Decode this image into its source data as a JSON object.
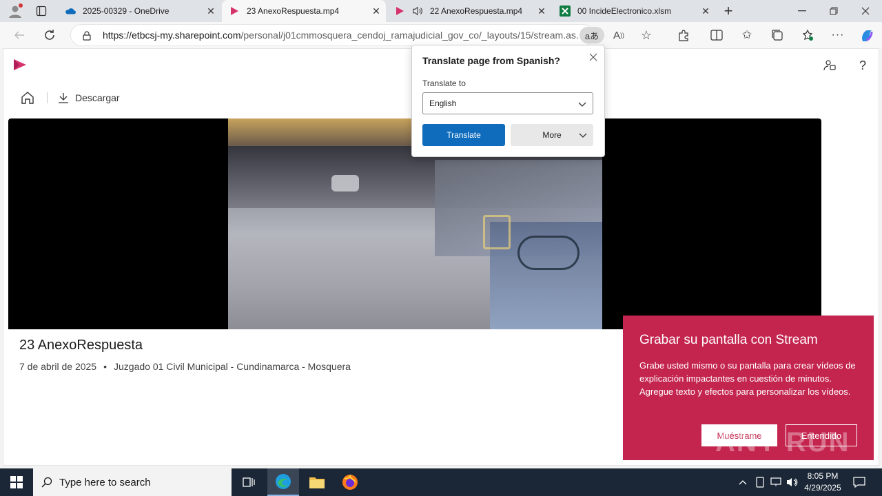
{
  "tabs": [
    {
      "label": "2025-00329 - OneDrive"
    },
    {
      "label": "23 AnexoRespuesta.mp4"
    },
    {
      "label": "22 AnexoRespuesta.mp4"
    },
    {
      "label": "00 IncideElectronico.xlsm"
    }
  ],
  "address": {
    "url_host": "https://etbcsj-my.sharepoint.com",
    "url_path": "/personal/j01cmmosquera_cendoj_ramajudicial_gov_co/_layouts/15/stream.as..."
  },
  "toolbar": {
    "download_label": "Descargar"
  },
  "video": {
    "title": "23 AnexoRespuesta",
    "date": "7 de abril de 2025",
    "separator": "•",
    "owner": "Juzgado 01 Civil Municipal - Cundinamarca - Mosquera"
  },
  "translate_popup": {
    "title": "Translate page from Spanish?",
    "translate_to_label": "Translate to",
    "selected_language": "English",
    "translate_button": "Translate",
    "more_button": "More"
  },
  "promo": {
    "title": "Grabar su pantalla con Stream",
    "body": "Grabe usted mismo o su pantalla para crear vídeos de explicación impactantes en cuestión de minutos. Agregue texto y efectos para personalizar los vídeos.",
    "primary_button": "Muéstrame",
    "secondary_button": "Entendido"
  },
  "taskbar": {
    "search_placeholder": "Type here to search",
    "time": "8:05 PM",
    "date": "4/29/2025"
  },
  "watermark": "ANY RUN",
  "colors": {
    "accent": "#0f6cbd",
    "promo": "#c4254f",
    "stream": "#d6336c",
    "taskbar": "#1b2736"
  }
}
